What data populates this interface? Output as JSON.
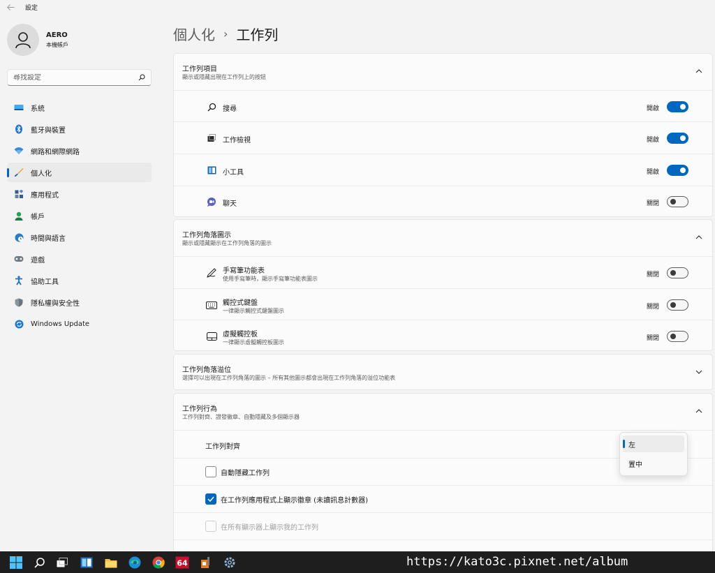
{
  "window": {
    "title": "設定"
  },
  "profile": {
    "name": "AERO",
    "subtitle": "本機帳戶"
  },
  "search": {
    "placeholder": "尋找設定"
  },
  "sidebar": {
    "items": [
      {
        "label": "系統",
        "icon": "monitor-icon"
      },
      {
        "label": "藍牙與裝置",
        "icon": "bluetooth-icon"
      },
      {
        "label": "網路和網際網路",
        "icon": "wifi-icon"
      },
      {
        "label": "個人化",
        "icon": "brush-icon",
        "active": true
      },
      {
        "label": "應用程式",
        "icon": "apps-icon"
      },
      {
        "label": "帳戶",
        "icon": "person-icon"
      },
      {
        "label": "時間與語言",
        "icon": "globe-clock-icon"
      },
      {
        "label": "遊戲",
        "icon": "gamepad-icon"
      },
      {
        "label": "協助工具",
        "icon": "accessibility-icon"
      },
      {
        "label": "隱私權與安全性",
        "icon": "shield-icon"
      },
      {
        "label": "Windows Update",
        "icon": "update-icon"
      }
    ]
  },
  "breadcrumb": {
    "parent": "個人化",
    "separator": "›",
    "current": "工作列"
  },
  "taskbar_items": {
    "title": "工作列項目",
    "subtitle": "顯示或隱藏出現在工作列上的按鈕",
    "rows": [
      {
        "label": "搜尋",
        "state": "開啟",
        "on": true
      },
      {
        "label": "工作檢視",
        "state": "開啟",
        "on": true
      },
      {
        "label": "小工具",
        "state": "開啟",
        "on": true
      },
      {
        "label": "聊天",
        "state": "關閉",
        "on": false
      }
    ]
  },
  "corner_icons": {
    "title": "工作列角落圖示",
    "subtitle": "顯示或隱藏顯示在工作列角落的圖示",
    "rows": [
      {
        "label": "手寫筆功能表",
        "sub": "使用手寫筆時，顯示手寫筆功能表圖示",
        "state": "關閉",
        "on": false
      },
      {
        "label": "觸控式鍵盤",
        "sub": "一律顯示觸控式鍵盤圖示",
        "state": "關閉",
        "on": false
      },
      {
        "label": "虛擬觸控板",
        "sub": "一律顯示虛擬觸控板圖示",
        "state": "關閉",
        "on": false
      }
    ]
  },
  "corner_overflow": {
    "title": "工作列角落溢位",
    "subtitle": "選擇可以出現在工作列角落的圖示 – 所有其他圖示都會出現在工作列角落的溢位功能表"
  },
  "behaviors": {
    "title": "工作列行為",
    "subtitle": "工作列對齊、證發徽章、自動隱藏及多個顯示器",
    "alignment_label": "工作列對齊",
    "alignment_options": [
      "左",
      "置中"
    ],
    "alignment_selected": "左",
    "checkboxes": [
      {
        "label": "自動隱藏工作列",
        "checked": false,
        "disabled": false
      },
      {
        "label": "在工作列應用程式上顯示徽章 (未讀訊息計數器)",
        "checked": true,
        "disabled": false
      },
      {
        "label": "在所有顯示器上顯示我的工作列",
        "checked": false,
        "disabled": true
      }
    ]
  },
  "watermark": "https://kato3c.pixnet.net/album",
  "colors": {
    "accent": "#0067c0",
    "background": "#f3f3f3",
    "card": "#fbfbfb",
    "taskbar": "#1e1e1e"
  }
}
